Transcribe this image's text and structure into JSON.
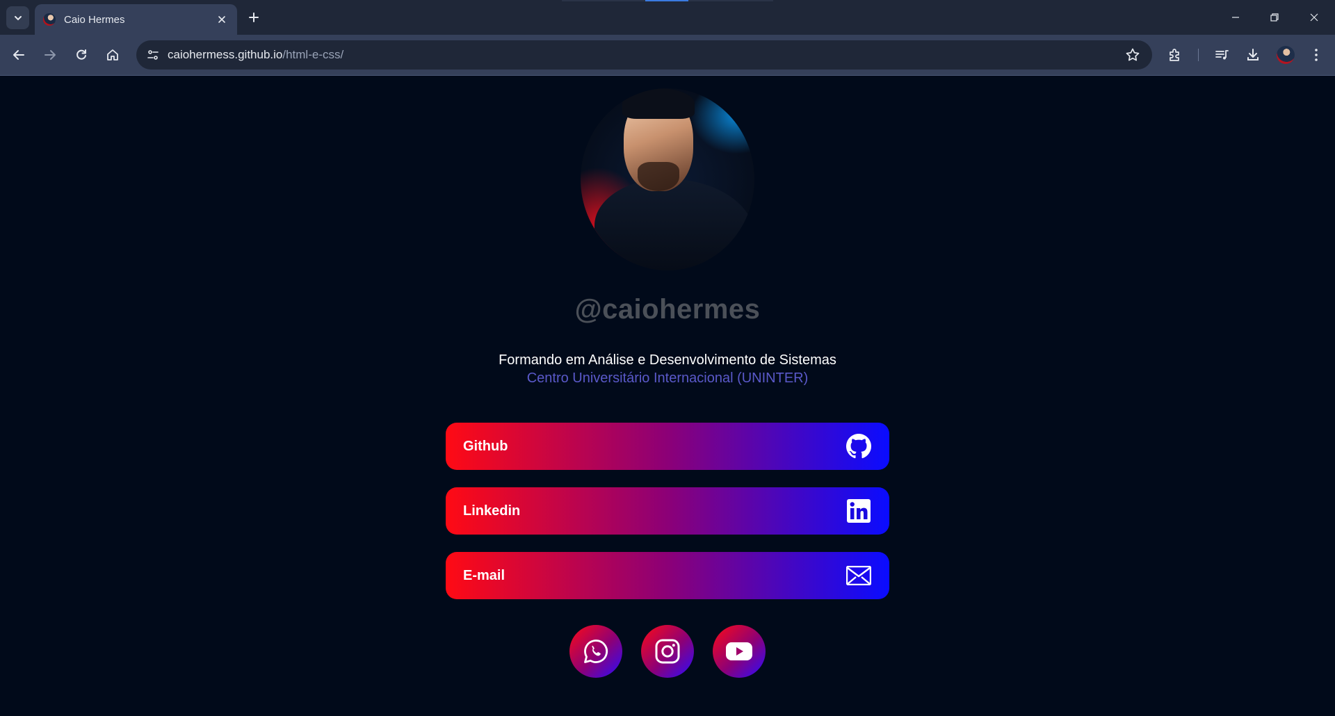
{
  "browser": {
    "tab_title": "Caio Hermes",
    "url_host": "caiohermess.github.io",
    "url_path": "/html-e-css/"
  },
  "profile": {
    "username": "@caiohermes",
    "headline": "Formando em Análise e Desenvolvimento de Sistemas",
    "institution": "Centro Universitário Internacional (UNINTER)"
  },
  "links": [
    {
      "label": "Github",
      "icon": "github-icon"
    },
    {
      "label": "Linkedin",
      "icon": "linkedin-icon"
    },
    {
      "label": "E-mail",
      "icon": "mail-icon"
    }
  ],
  "social": [
    {
      "name": "whatsapp",
      "icon": "whatsapp-icon"
    },
    {
      "name": "instagram",
      "icon": "instagram-icon"
    },
    {
      "name": "youtube",
      "icon": "youtube-icon"
    }
  ],
  "colors": {
    "background": "#010a1a",
    "gradient_start": "#ff0a14",
    "gradient_end": "#0a0cff",
    "username": "#4b5058",
    "institution": "#5a59c9"
  }
}
